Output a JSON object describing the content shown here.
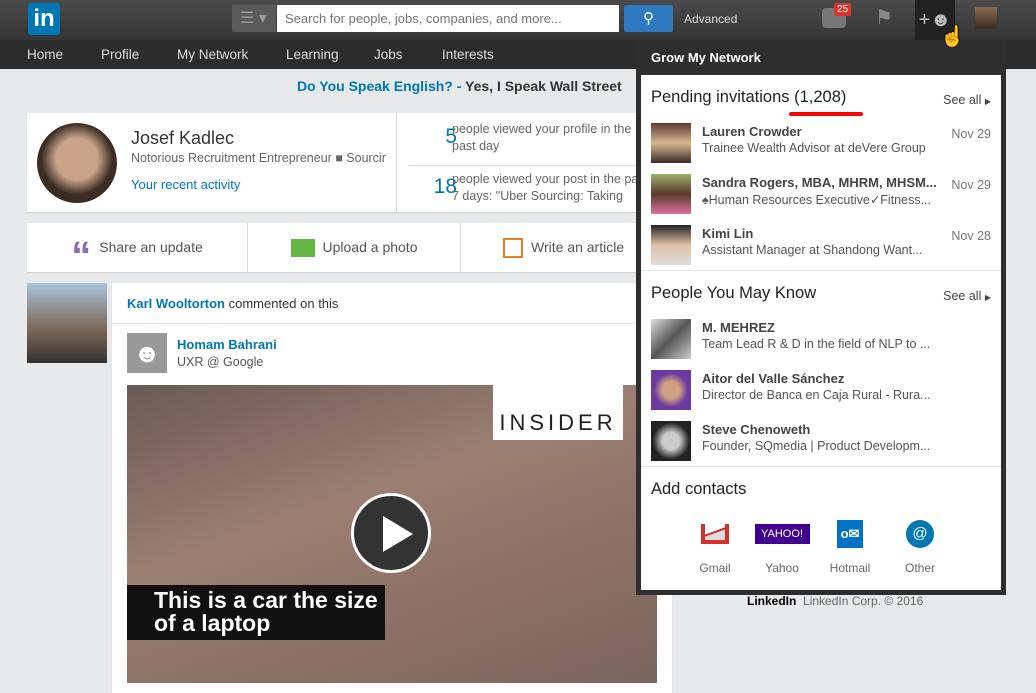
{
  "topbar": {
    "search_placeholder": "Search for people, jobs, companies, and more...",
    "advanced": "Advanced",
    "messages_count": "25",
    "logo": "in"
  },
  "nav": [
    {
      "label": "Home"
    },
    {
      "label": "Profile"
    },
    {
      "label": "My Network"
    },
    {
      "label": "Learning"
    },
    {
      "label": "Jobs"
    },
    {
      "label": "Interests"
    }
  ],
  "promo": {
    "link": "Do You Speak English? -",
    "text": " Yes, I Speak Wall Street"
  },
  "profile": {
    "name": "Josef Kadlec",
    "headline": "Notorious Recruitment Entrepreneur ■ Sourcing",
    "recent_activity": "Your recent activity",
    "stats": [
      {
        "num": "5",
        "line1": "people viewed your profile in the",
        "line2": "past day"
      },
      {
        "num": "18",
        "line1": "people viewed your post in the past",
        "line2": "7 days: \"Uber Sourcing: Taking"
      }
    ]
  },
  "share": [
    {
      "label": "Share an update",
      "icon": "quote-icon",
      "color": "#8a6bb5"
    },
    {
      "label": "Upload a photo",
      "icon": "photo-icon",
      "color": "#65b745"
    },
    {
      "label": "Write an article",
      "icon": "edit-icon",
      "color": "#e97c22"
    }
  ],
  "feed": {
    "actor": "Karl Wooltorton",
    "action": " commented on this",
    "author": "Homam Bahrani",
    "author_headline": "UXR @ Google",
    "video": {
      "brand": "INSIDER",
      "caption": "This is a car the size of a laptop"
    }
  },
  "dropdown": {
    "title": "Grow My Network",
    "pending": {
      "title": "Pending invitations (1,208)",
      "see_all": "See all",
      "items": [
        {
          "name": "Lauren Crowder",
          "headline": "Trainee Wealth Advisor at deVere Group",
          "date": "Nov 29"
        },
        {
          "name": "Sandra Rogers, MBA, MHRM, MHSM...",
          "headline": "♠Human Resources Executive✓Fitness...",
          "date": "Nov 29"
        },
        {
          "name": "Kimi Lin",
          "headline": "Assistant Manager at Shandong Want...",
          "date": "Nov 28"
        }
      ]
    },
    "pymk": {
      "title": "People You May Know",
      "see_all": "See all",
      "items": [
        {
          "name": "M. MEHREZ",
          "headline": "Team Lead R & D in the field of NLP to ..."
        },
        {
          "name": "Aitor del Valle Sánchez",
          "headline": "Director de Banca en Caja Rural - Rura..."
        },
        {
          "name": "Steve Chenoweth",
          "headline": "Founder, SQmedia | Product Developm..."
        }
      ]
    },
    "add_contacts": {
      "title": "Add contacts",
      "items": [
        {
          "label": "Gmail",
          "icon": "gmail-icon"
        },
        {
          "label": "Yahoo",
          "icon": "yahoo-icon",
          "logo_text": "YAHOO!"
        },
        {
          "label": "Hotmail",
          "icon": "outlook-icon"
        },
        {
          "label": "Other",
          "icon": "at-icon"
        }
      ]
    }
  },
  "footer": {
    "logo": "LinkedIn",
    "text": "LinkedIn Corp. © 2016"
  },
  "colors": {
    "accent": "#0077b5",
    "annotation": "#ff0000"
  }
}
